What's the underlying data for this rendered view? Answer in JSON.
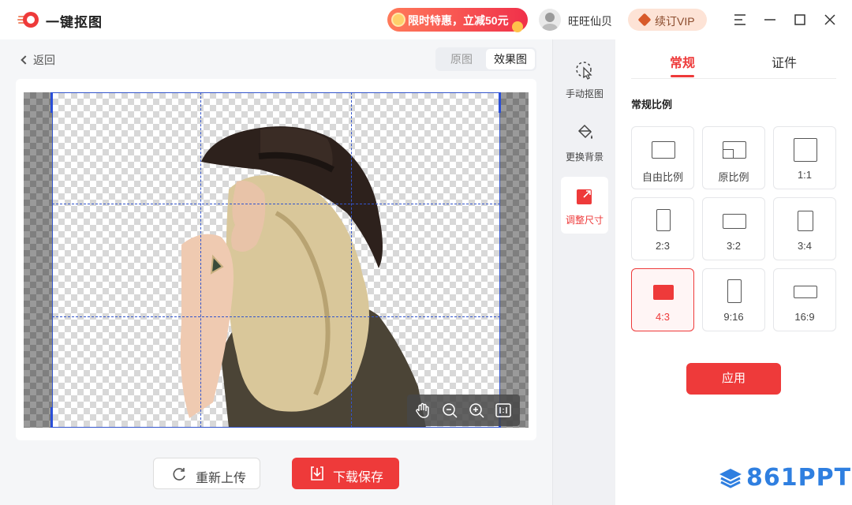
{
  "app": {
    "name": "一键抠图",
    "logo_icon": "logo-icon"
  },
  "header": {
    "promo_label": "限时特惠，立减50元",
    "username": "旺旺仙贝",
    "vip_label": "续订VIP",
    "window_controls": [
      "menu-icon",
      "minimize-icon",
      "maximize-icon",
      "close-icon"
    ]
  },
  "editor": {
    "back_label": "返回",
    "view_toggle": [
      {
        "label": "原图",
        "active": false
      },
      {
        "label": "效果图",
        "active": true
      }
    ],
    "zoom_tools": [
      "hand-icon",
      "zoom-out-icon",
      "zoom-in-icon",
      "actual-size-icon"
    ]
  },
  "actions": {
    "reupload_label": "重新上传",
    "save_label": "下载保存"
  },
  "tools": [
    {
      "label": "手动抠图",
      "icon": "manual-cutout-icon",
      "active": false
    },
    {
      "label": "更换背景",
      "icon": "paint-bucket-icon",
      "active": false
    },
    {
      "label": "调整尺寸",
      "icon": "resize-icon",
      "active": true
    }
  ],
  "panel": {
    "tabs": [
      {
        "label": "常规",
        "active": true
      },
      {
        "label": "证件",
        "active": false
      }
    ],
    "section_title": "常规比例",
    "ratios": [
      {
        "label": "自由比例",
        "active": false
      },
      {
        "label": "原比例",
        "active": false
      },
      {
        "label": "1:1",
        "active": false
      },
      {
        "label": "2:3",
        "active": false
      },
      {
        "label": "3:2",
        "active": false
      },
      {
        "label": "3:4",
        "active": false
      },
      {
        "label": "4:3",
        "active": true
      },
      {
        "label": "9:16",
        "active": false
      },
      {
        "label": "16:9",
        "active": false
      }
    ],
    "apply_label": "应用"
  },
  "watermark": "861PPT",
  "colors": {
    "accent": "#ee3a3a",
    "crop_line": "#3355cc",
    "watermark": "#2f7fe0"
  }
}
